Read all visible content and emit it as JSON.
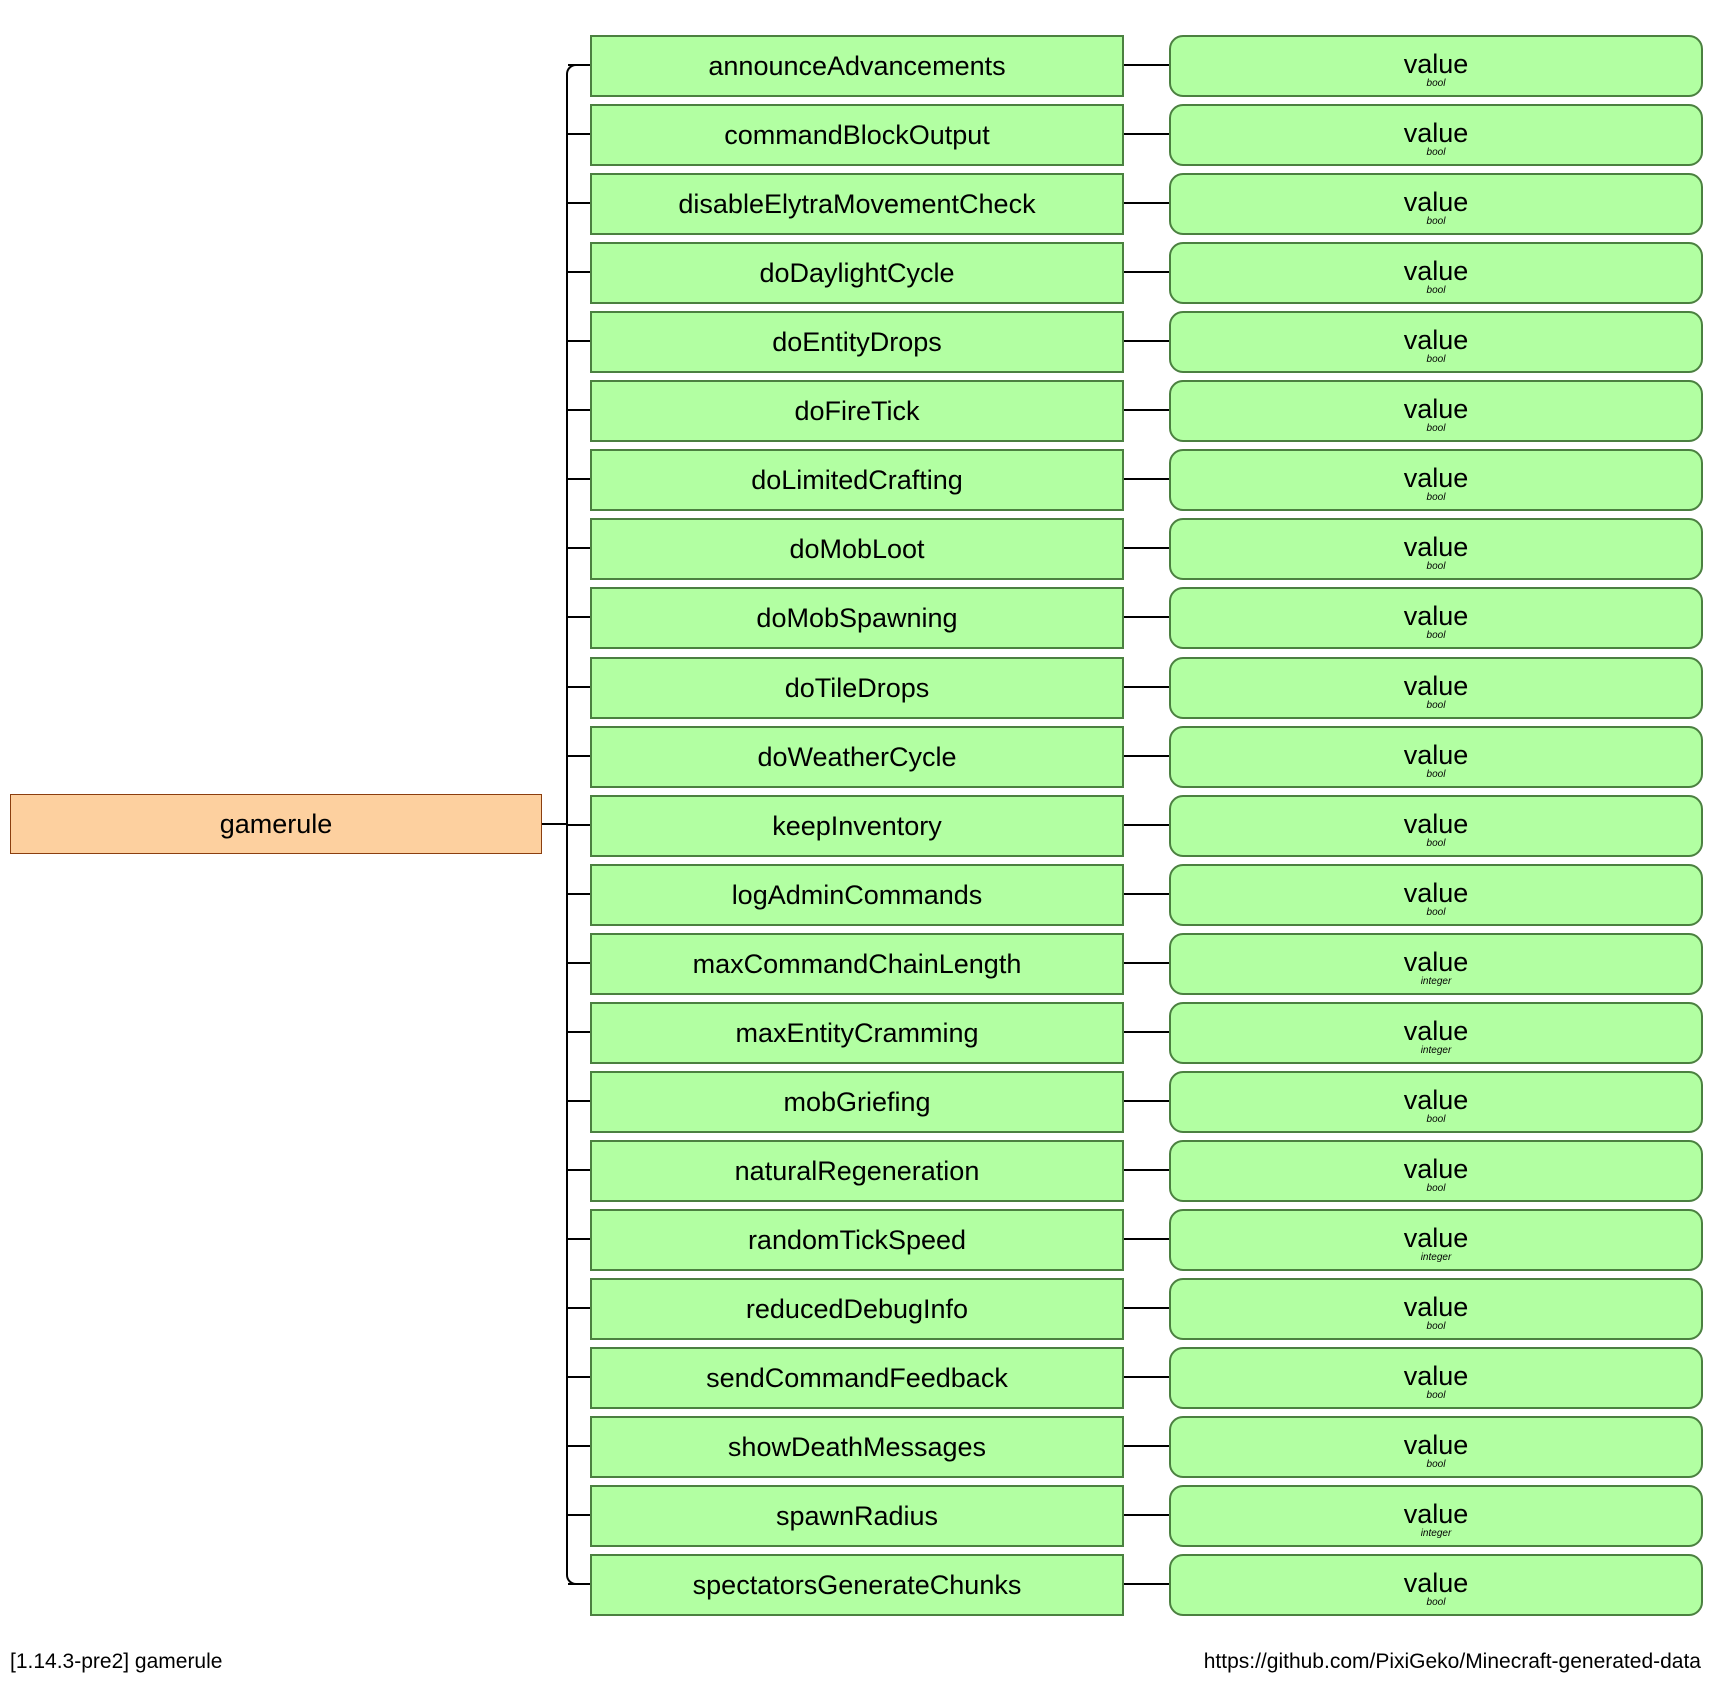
{
  "root": {
    "label": "gamerule"
  },
  "colors": {
    "root_fill": "#fdd09f",
    "node_fill": "#b2ffa2",
    "node_border": "#4b8040"
  },
  "rules": [
    {
      "name": "announceAdvancements",
      "value": "value",
      "type": "bool"
    },
    {
      "name": "commandBlockOutput",
      "value": "value",
      "type": "bool"
    },
    {
      "name": "disableElytraMovementCheck",
      "value": "value",
      "type": "bool"
    },
    {
      "name": "doDaylightCycle",
      "value": "value",
      "type": "bool"
    },
    {
      "name": "doEntityDrops",
      "value": "value",
      "type": "bool"
    },
    {
      "name": "doFireTick",
      "value": "value",
      "type": "bool"
    },
    {
      "name": "doLimitedCrafting",
      "value": "value",
      "type": "bool"
    },
    {
      "name": "doMobLoot",
      "value": "value",
      "type": "bool"
    },
    {
      "name": "doMobSpawning",
      "value": "value",
      "type": "bool"
    },
    {
      "name": "doTileDrops",
      "value": "value",
      "type": "bool"
    },
    {
      "name": "doWeatherCycle",
      "value": "value",
      "type": "bool"
    },
    {
      "name": "keepInventory",
      "value": "value",
      "type": "bool"
    },
    {
      "name": "logAdminCommands",
      "value": "value",
      "type": "bool"
    },
    {
      "name": "maxCommandChainLength",
      "value": "value",
      "type": "integer"
    },
    {
      "name": "maxEntityCramming",
      "value": "value",
      "type": "integer"
    },
    {
      "name": "mobGriefing",
      "value": "value",
      "type": "bool"
    },
    {
      "name": "naturalRegeneration",
      "value": "value",
      "type": "bool"
    },
    {
      "name": "randomTickSpeed",
      "value": "value",
      "type": "integer"
    },
    {
      "name": "reducedDebugInfo",
      "value": "value",
      "type": "bool"
    },
    {
      "name": "sendCommandFeedback",
      "value": "value",
      "type": "bool"
    },
    {
      "name": "showDeathMessages",
      "value": "value",
      "type": "bool"
    },
    {
      "name": "spawnRadius",
      "value": "value",
      "type": "integer"
    },
    {
      "name": "spectatorsGenerateChunks",
      "value": "value",
      "type": "bool"
    }
  ],
  "footer": {
    "left": "[1.14.3-pre2] gamerule",
    "right": "https://github.com/PixiGeko/Minecraft-generated-data"
  }
}
